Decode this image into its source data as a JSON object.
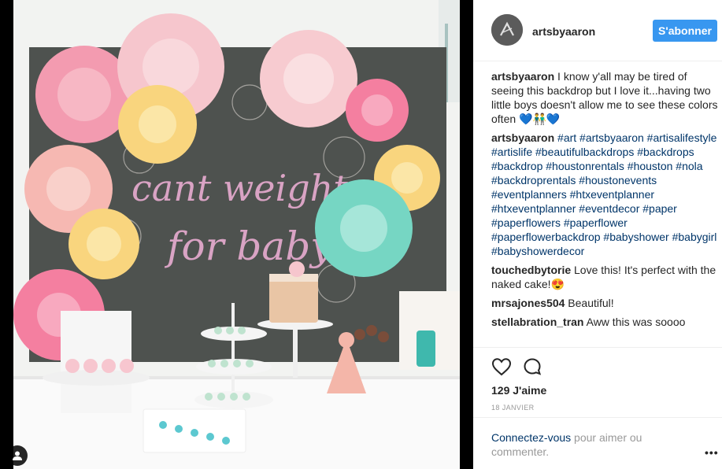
{
  "post": {
    "username": "artsbyaaron",
    "follow_label": "S'abonner",
    "likes": "129 J'aime",
    "date": "18 JANVIER"
  },
  "comments": [
    {
      "user": "artsbyaaron",
      "text": "I know y'all may be tired of seeing this backdrop but I love it...having two little boys doesn't allow me to see these colors often 💙👬💙"
    },
    {
      "user": "artsbyaaron",
      "text": "#art #artsbyaaron #artisalifestyle #artislife #beautifulbackdrops #backdrops #backdrop #houstonrentals #houston #nola #backdroprentals #houstonevents #eventplanners #htxeventplanner #htxeventplanner #eventdecor #paper #paperflowers #paperflower #paperflowerbackdrop #babyshower #babygirl #babyshowerdecor"
    },
    {
      "user": "touchedbytorie",
      "text": "Love this! It's perfect with the naked cake!😍"
    },
    {
      "user": "mrsajones504",
      "text": "Beautiful!"
    },
    {
      "user": "stellabration_tran",
      "text": "Aww this was soooo"
    }
  ],
  "photo": {
    "sign_text_line1": "cant weight",
    "sign_text_line2": "for baby"
  },
  "login": {
    "link": "Connectez-vous",
    "rest": " pour aimer ou commenter."
  },
  "more_icon": "•••",
  "icons": {
    "like": "heart-outline-icon",
    "comment": "speech-bubble-icon",
    "user_tag": "person-icon",
    "more": "ellipsis-icon"
  },
  "colors": {
    "follow_button": "#3897f0",
    "hashtag": "#003569",
    "muted": "#999999"
  }
}
